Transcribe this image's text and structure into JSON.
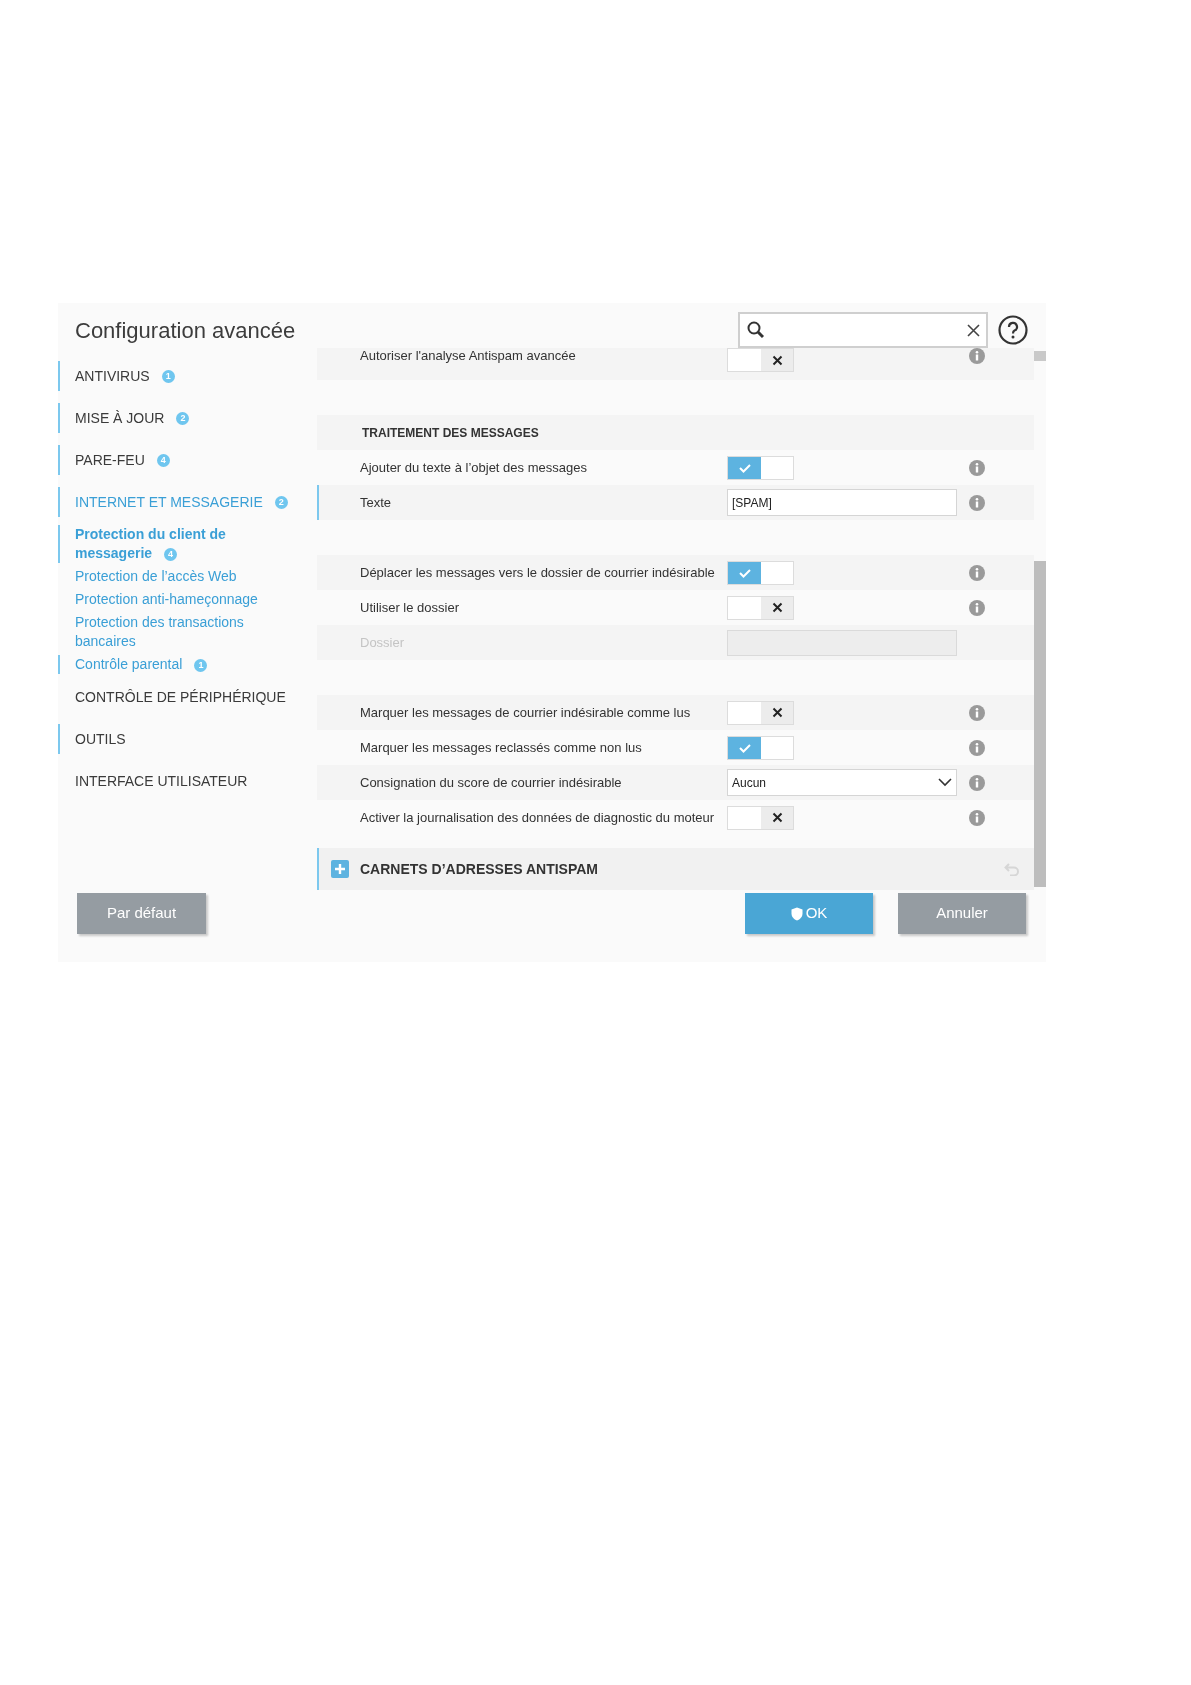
{
  "window": {
    "title": "Configuration avancée"
  },
  "sidebar": {
    "items": [
      {
        "label": "ANTIVIRUS",
        "badge": "1",
        "accent": true,
        "expanded": false
      },
      {
        "label": "MISE À JOUR",
        "badge": "2",
        "accent": true,
        "expanded": false
      },
      {
        "label": "PARE-FEU",
        "badge": "4",
        "accent": true,
        "expanded": false
      },
      {
        "label": "INTERNET ET MESSAGERIE",
        "badge": "2",
        "accent": true,
        "expanded": true,
        "children": [
          {
            "label": "Protection du client de messagerie",
            "badge": "4",
            "accent": true,
            "selected": true
          },
          {
            "label": "Protection de l’accès Web",
            "accent": false,
            "selected": false
          },
          {
            "label": "Protection anti-hameçonnage",
            "accent": false,
            "selected": false
          },
          {
            "label": "Protection des transactions bancaires",
            "accent": false,
            "selected": false
          },
          {
            "label": "Contrôle parental",
            "badge": "1",
            "accent": true,
            "selected": false
          }
        ]
      },
      {
        "label": "CONTRÔLE DE PÉRIPHÉRIQUE",
        "accent": false,
        "expanded": false
      },
      {
        "label": "OUTILS",
        "accent": true,
        "expanded": false
      },
      {
        "label": "INTERFACE UTILISATEUR",
        "accent": false,
        "expanded": false
      }
    ]
  },
  "rows": [
    {
      "kind": "toggle",
      "label": "Autoriser l'analyse Antispam avancée",
      "on": false,
      "highlighted": false
    },
    {
      "kind": "spacer"
    },
    {
      "kind": "header",
      "label": "TRAITEMENT DES MESSAGES"
    },
    {
      "kind": "toggle",
      "label": "Ajouter du texte à l’objet des messages",
      "on": true,
      "highlighted": false
    },
    {
      "kind": "text",
      "label": "Texte",
      "value": "[SPAM]",
      "disabled": false,
      "highlighted": true
    },
    {
      "kind": "spacer"
    },
    {
      "kind": "toggle",
      "label": "Déplacer les messages vers le dossier de courrier indésirable",
      "on": true,
      "highlighted": false
    },
    {
      "kind": "toggle",
      "label": "Utiliser le dossier",
      "on": false,
      "highlighted": false
    },
    {
      "kind": "text",
      "label": "Dossier",
      "disabled": true,
      "highlighted": false
    },
    {
      "kind": "spacer"
    },
    {
      "kind": "toggle",
      "label": "Marquer les messages de courrier indésirable comme lus",
      "on": false,
      "highlighted": false
    },
    {
      "kind": "toggle",
      "label": "Marquer les messages reclassés comme non lus",
      "on": true,
      "highlighted": false
    },
    {
      "kind": "select",
      "label": "Consignation du score de courrier indésirable",
      "value": "Aucun",
      "highlighted": false
    },
    {
      "kind": "toggle",
      "label": "Activer la journalisation des données de diagnostic du moteur",
      "on": false,
      "highlighted": false
    }
  ],
  "section": {
    "label": "CARNETS D’ADRESSES ANTISPAM",
    "expanded": false
  },
  "buttons": {
    "default": "Par défaut",
    "ok": "OK",
    "cancel": "Annuler"
  }
}
